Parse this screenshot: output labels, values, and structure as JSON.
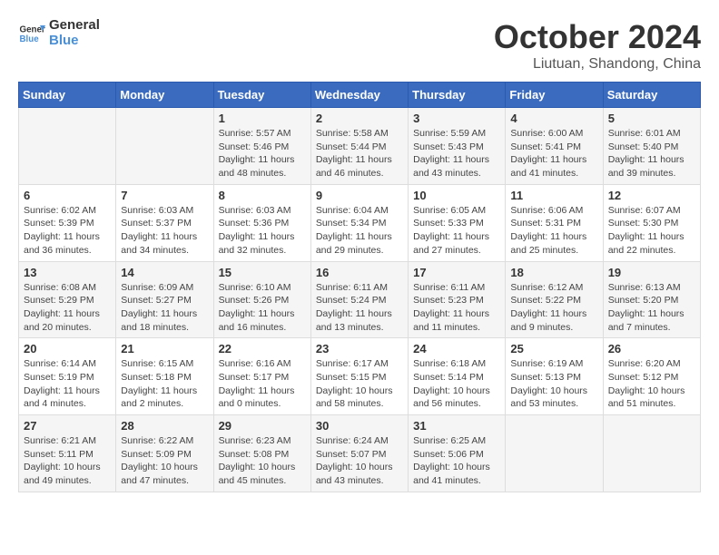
{
  "logo": {
    "line1": "General",
    "line2": "Blue"
  },
  "title": "October 2024",
  "subtitle": "Liutuan, Shandong, China",
  "days_of_week": [
    "Sunday",
    "Monday",
    "Tuesday",
    "Wednesday",
    "Thursday",
    "Friday",
    "Saturday"
  ],
  "weeks": [
    [
      {
        "day": "",
        "info": ""
      },
      {
        "day": "",
        "info": ""
      },
      {
        "day": "1",
        "info": "Sunrise: 5:57 AM\nSunset: 5:46 PM\nDaylight: 11 hours and 48 minutes."
      },
      {
        "day": "2",
        "info": "Sunrise: 5:58 AM\nSunset: 5:44 PM\nDaylight: 11 hours and 46 minutes."
      },
      {
        "day": "3",
        "info": "Sunrise: 5:59 AM\nSunset: 5:43 PM\nDaylight: 11 hours and 43 minutes."
      },
      {
        "day": "4",
        "info": "Sunrise: 6:00 AM\nSunset: 5:41 PM\nDaylight: 11 hours and 41 minutes."
      },
      {
        "day": "5",
        "info": "Sunrise: 6:01 AM\nSunset: 5:40 PM\nDaylight: 11 hours and 39 minutes."
      }
    ],
    [
      {
        "day": "6",
        "info": "Sunrise: 6:02 AM\nSunset: 5:39 PM\nDaylight: 11 hours and 36 minutes."
      },
      {
        "day": "7",
        "info": "Sunrise: 6:03 AM\nSunset: 5:37 PM\nDaylight: 11 hours and 34 minutes."
      },
      {
        "day": "8",
        "info": "Sunrise: 6:03 AM\nSunset: 5:36 PM\nDaylight: 11 hours and 32 minutes."
      },
      {
        "day": "9",
        "info": "Sunrise: 6:04 AM\nSunset: 5:34 PM\nDaylight: 11 hours and 29 minutes."
      },
      {
        "day": "10",
        "info": "Sunrise: 6:05 AM\nSunset: 5:33 PM\nDaylight: 11 hours and 27 minutes."
      },
      {
        "day": "11",
        "info": "Sunrise: 6:06 AM\nSunset: 5:31 PM\nDaylight: 11 hours and 25 minutes."
      },
      {
        "day": "12",
        "info": "Sunrise: 6:07 AM\nSunset: 5:30 PM\nDaylight: 11 hours and 22 minutes."
      }
    ],
    [
      {
        "day": "13",
        "info": "Sunrise: 6:08 AM\nSunset: 5:29 PM\nDaylight: 11 hours and 20 minutes."
      },
      {
        "day": "14",
        "info": "Sunrise: 6:09 AM\nSunset: 5:27 PM\nDaylight: 11 hours and 18 minutes."
      },
      {
        "day": "15",
        "info": "Sunrise: 6:10 AM\nSunset: 5:26 PM\nDaylight: 11 hours and 16 minutes."
      },
      {
        "day": "16",
        "info": "Sunrise: 6:11 AM\nSunset: 5:24 PM\nDaylight: 11 hours and 13 minutes."
      },
      {
        "day": "17",
        "info": "Sunrise: 6:11 AM\nSunset: 5:23 PM\nDaylight: 11 hours and 11 minutes."
      },
      {
        "day": "18",
        "info": "Sunrise: 6:12 AM\nSunset: 5:22 PM\nDaylight: 11 hours and 9 minutes."
      },
      {
        "day": "19",
        "info": "Sunrise: 6:13 AM\nSunset: 5:20 PM\nDaylight: 11 hours and 7 minutes."
      }
    ],
    [
      {
        "day": "20",
        "info": "Sunrise: 6:14 AM\nSunset: 5:19 PM\nDaylight: 11 hours and 4 minutes."
      },
      {
        "day": "21",
        "info": "Sunrise: 6:15 AM\nSunset: 5:18 PM\nDaylight: 11 hours and 2 minutes."
      },
      {
        "day": "22",
        "info": "Sunrise: 6:16 AM\nSunset: 5:17 PM\nDaylight: 11 hours and 0 minutes."
      },
      {
        "day": "23",
        "info": "Sunrise: 6:17 AM\nSunset: 5:15 PM\nDaylight: 10 hours and 58 minutes."
      },
      {
        "day": "24",
        "info": "Sunrise: 6:18 AM\nSunset: 5:14 PM\nDaylight: 10 hours and 56 minutes."
      },
      {
        "day": "25",
        "info": "Sunrise: 6:19 AM\nSunset: 5:13 PM\nDaylight: 10 hours and 53 minutes."
      },
      {
        "day": "26",
        "info": "Sunrise: 6:20 AM\nSunset: 5:12 PM\nDaylight: 10 hours and 51 minutes."
      }
    ],
    [
      {
        "day": "27",
        "info": "Sunrise: 6:21 AM\nSunset: 5:11 PM\nDaylight: 10 hours and 49 minutes."
      },
      {
        "day": "28",
        "info": "Sunrise: 6:22 AM\nSunset: 5:09 PM\nDaylight: 10 hours and 47 minutes."
      },
      {
        "day": "29",
        "info": "Sunrise: 6:23 AM\nSunset: 5:08 PM\nDaylight: 10 hours and 45 minutes."
      },
      {
        "day": "30",
        "info": "Sunrise: 6:24 AM\nSunset: 5:07 PM\nDaylight: 10 hours and 43 minutes."
      },
      {
        "day": "31",
        "info": "Sunrise: 6:25 AM\nSunset: 5:06 PM\nDaylight: 10 hours and 41 minutes."
      },
      {
        "day": "",
        "info": ""
      },
      {
        "day": "",
        "info": ""
      }
    ]
  ]
}
